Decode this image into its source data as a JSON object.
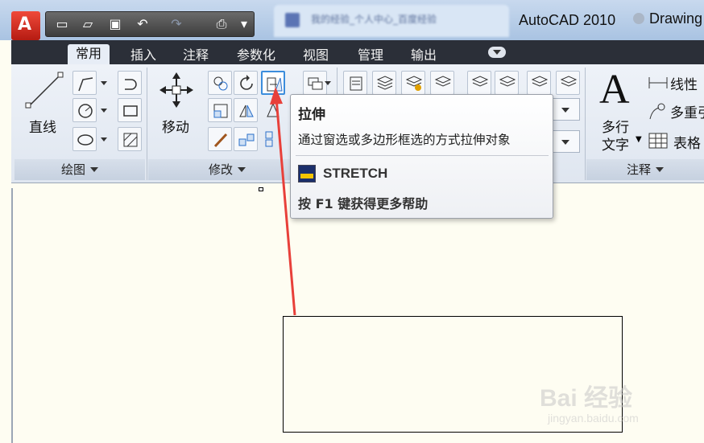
{
  "app": {
    "logo": "A",
    "title": "AutoCAD 2010",
    "doc_tab": "Drawing",
    "blurred_tab": "我的经验_个人中心_百度经验"
  },
  "qat": [
    "new-icon",
    "open-icon",
    "save-icon",
    "undo-icon",
    "redo-icon",
    "plot-icon",
    "dropdown-icon"
  ],
  "tabs": [
    {
      "label": "常用",
      "active": true
    },
    {
      "label": "插入"
    },
    {
      "label": "注释"
    },
    {
      "label": "参数化"
    },
    {
      "label": "视图"
    },
    {
      "label": "管理"
    },
    {
      "label": "输出"
    }
  ],
  "panels": {
    "draw": {
      "big_button": "直线",
      "footer": "绘图"
    },
    "modify": {
      "big_button": "移动",
      "footer": "修改"
    },
    "annotation": {
      "big_letter": "A",
      "big_button_1": "多行",
      "big_button_2": "文字",
      "items": [
        "线性",
        "多重引",
        "表格"
      ],
      "footer": "注释"
    }
  },
  "tooltip": {
    "title": "拉伸",
    "description": "通过窗选或多边形框选的方式拉伸对象",
    "command": "STRETCH",
    "help": "按 F1 键获得更多帮助"
  },
  "watermark": {
    "main": "Bai 经验",
    "sub": "jingyan.baidu.com"
  },
  "colors": {
    "arrow": "#e8403a",
    "accent": "#3c8ddc",
    "canvas": "#fefdf2"
  }
}
